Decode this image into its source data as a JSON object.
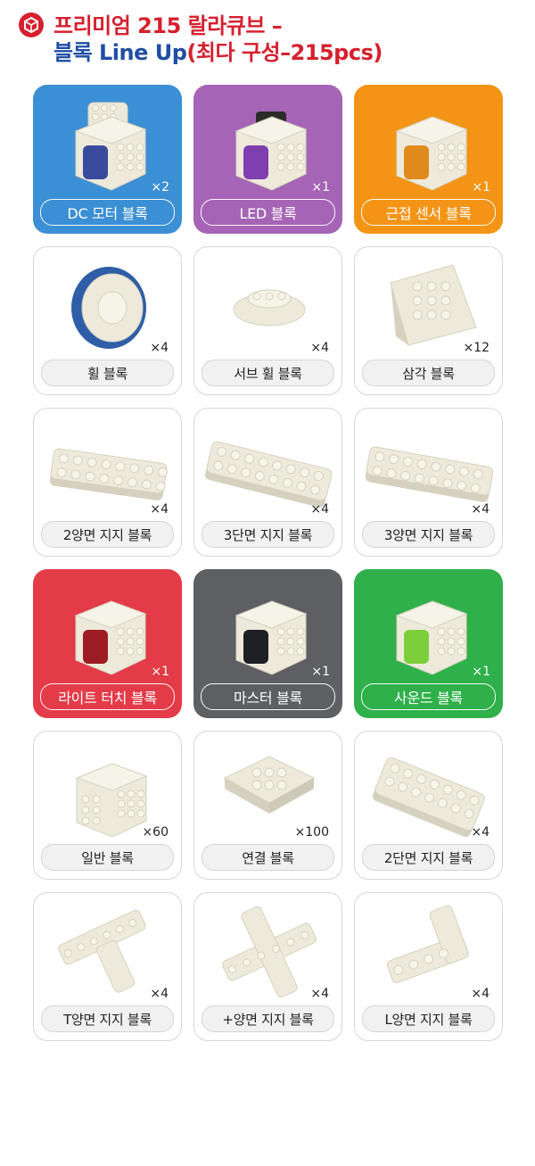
{
  "header": {
    "line1_red": "프리미엄 215 랄라큐브 –",
    "line2_blue": "블록 Line Up",
    "line2_red": "(최다 구성–215pcs)",
    "icon": "cube-badge-icon"
  },
  "colors": {
    "blue": "#3b8fd4",
    "purple": "#a564b5",
    "orange": "#f39416",
    "red": "#e33b47",
    "gray": "#5d5f63",
    "green": "#2fb04a"
  },
  "blocks": [
    {
      "label": "DC 모터 블록",
      "count": "×2",
      "style": "blue",
      "icon": "dc-motor-block-icon"
    },
    {
      "label": "LED 블록",
      "count": "×1",
      "style": "purple",
      "icon": "led-block-icon"
    },
    {
      "label": "근접 센서 블록",
      "count": "×1",
      "style": "orange",
      "icon": "proximity-sensor-block-icon"
    },
    {
      "label": "휠 블록",
      "count": "×4",
      "style": "white",
      "icon": "wheel-block-icon"
    },
    {
      "label": "서브 휠 블록",
      "count": "×4",
      "style": "white",
      "icon": "sub-wheel-block-icon"
    },
    {
      "label": "삼각 블록",
      "count": "×12",
      "style": "white",
      "icon": "triangle-block-icon"
    },
    {
      "label": "2양면 지지 블록",
      "count": "×4",
      "style": "white",
      "icon": "double-side-support-2-icon"
    },
    {
      "label": "3단면 지지 블록",
      "count": "×4",
      "style": "white",
      "icon": "single-side-support-3-icon"
    },
    {
      "label": "3양면 지지 블록",
      "count": "×4",
      "style": "white",
      "icon": "double-side-support-3-icon"
    },
    {
      "label": "라이트 터치 블록",
      "count": "×1",
      "style": "red",
      "icon": "light-touch-block-icon"
    },
    {
      "label": "마스터 블록",
      "count": "×1",
      "style": "gray",
      "icon": "master-block-icon"
    },
    {
      "label": "사운드 블록",
      "count": "×1",
      "style": "green",
      "icon": "sound-block-icon"
    },
    {
      "label": "일반 블록",
      "count": "×60",
      "style": "white",
      "icon": "general-block-icon"
    },
    {
      "label": "연결 블록",
      "count": "×100",
      "style": "white",
      "icon": "connector-block-icon"
    },
    {
      "label": "2단면 지지 블록",
      "count": "×4",
      "style": "white",
      "icon": "single-side-support-2-icon"
    },
    {
      "label": "T양면 지지 블록",
      "count": "×4",
      "style": "white",
      "icon": "t-support-block-icon"
    },
    {
      "label": "+양면 지지 블록",
      "count": "×4",
      "style": "white",
      "icon": "plus-support-block-icon"
    },
    {
      "label": "L양면 지지 블록",
      "count": "×4",
      "style": "white",
      "icon": "l-support-block-icon"
    }
  ]
}
